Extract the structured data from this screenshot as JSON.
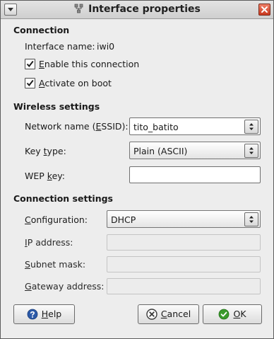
{
  "window": {
    "title": "Interface properties",
    "icons": {
      "menu": "window-menu-icon",
      "app": "network-icon",
      "close": "close-icon"
    }
  },
  "connection": {
    "heading": "Connection",
    "interface_name_label": "Interface name:",
    "interface_name_value": "iwi0",
    "enable": {
      "pre": "",
      "accel": "E",
      "post": "nable this connection",
      "checked": true
    },
    "activate": {
      "pre": "",
      "accel": "A",
      "post": "ctivate on boot",
      "checked": true
    }
  },
  "wireless": {
    "heading": "Wireless settings",
    "essid": {
      "pre": "Network name (",
      "accel": "E",
      "post": "SSID):",
      "value": "tito_batito"
    },
    "key_type": {
      "pre": "Key ",
      "accel": "t",
      "post": "ype:",
      "value": "Plain (ASCII)"
    },
    "wep_key": {
      "pre": "WEP ",
      "accel": "k",
      "post": "ey:",
      "value": ""
    }
  },
  "connection_settings": {
    "heading": "Connection settings",
    "configuration": {
      "pre": "",
      "accel": "C",
      "post": "onfiguration:",
      "value": "DHCP"
    },
    "ip_address": {
      "pre": "",
      "accel": "I",
      "post": "P address:",
      "value": ""
    },
    "subnet_mask": {
      "pre": "",
      "accel": "S",
      "post": "ubnet mask:",
      "value": ""
    },
    "gateway": {
      "pre": "",
      "accel": "G",
      "post": "ateway address:",
      "value": ""
    }
  },
  "buttons": {
    "help": {
      "pre": "",
      "accel": "H",
      "post": "elp",
      "icon": "help-icon"
    },
    "cancel": {
      "pre": "",
      "accel": "C",
      "post": "ancel",
      "icon": "cancel-icon"
    },
    "ok": {
      "pre": "",
      "accel": "O",
      "post": "K",
      "icon": "ok-check-icon"
    }
  },
  "colors": {
    "help_icon": "#2c5aa8",
    "cancel_icon": "#3a3a3a",
    "ok_icon": "#3a9a2c",
    "close_button": "#c8381e"
  }
}
